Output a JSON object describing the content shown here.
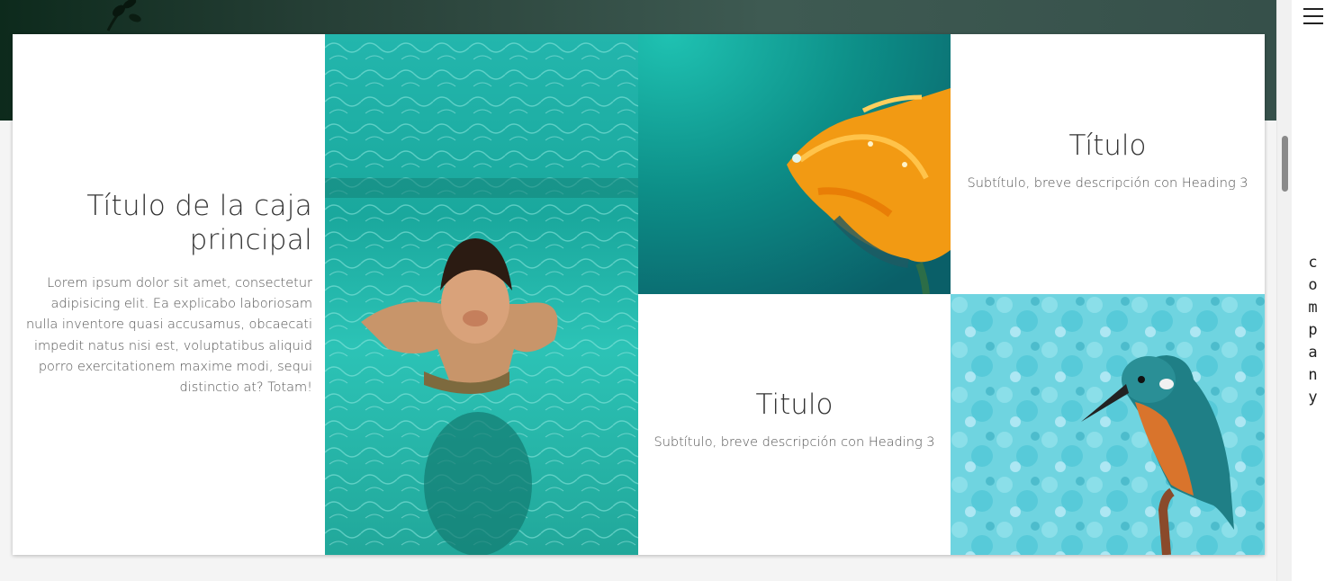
{
  "hero": {
    "icon": "leaf-silhouette"
  },
  "main_box": {
    "title": "Título de la caja principal",
    "text": "Lorem ipsum dolor sit amet, consectetur adipisicing elit. Ea explicabo laboriosam nulla inventore quasi accusamus, obcaecati impedit natus nisi est, voluptatibus aliquid porro exercitationem maxime modi, sequi distinctio at? Totam!"
  },
  "box_top_right": {
    "title": "Título",
    "subtitle": "Subtítulo, breve descripción con Heading 3"
  },
  "box_bottom_middle": {
    "title": "Titulo",
    "subtitle": "Subtítulo, breve descripción con Heading 3"
  },
  "images": {
    "swimmer": "underwater-swimmer-photo",
    "flower": "orange-flower-with-dew-photo",
    "bird": "kingfisher-on-branch-photo"
  },
  "side_nav": {
    "menu_icon": "hamburger-menu-icon",
    "brand_letters": [
      "c",
      "o",
      "m",
      "p",
      "a",
      "n",
      "y"
    ]
  },
  "colors": {
    "hero_band": "#263f36",
    "water": "#1fb7aa",
    "text_dark": "#333333",
    "text_body": "#555555"
  }
}
